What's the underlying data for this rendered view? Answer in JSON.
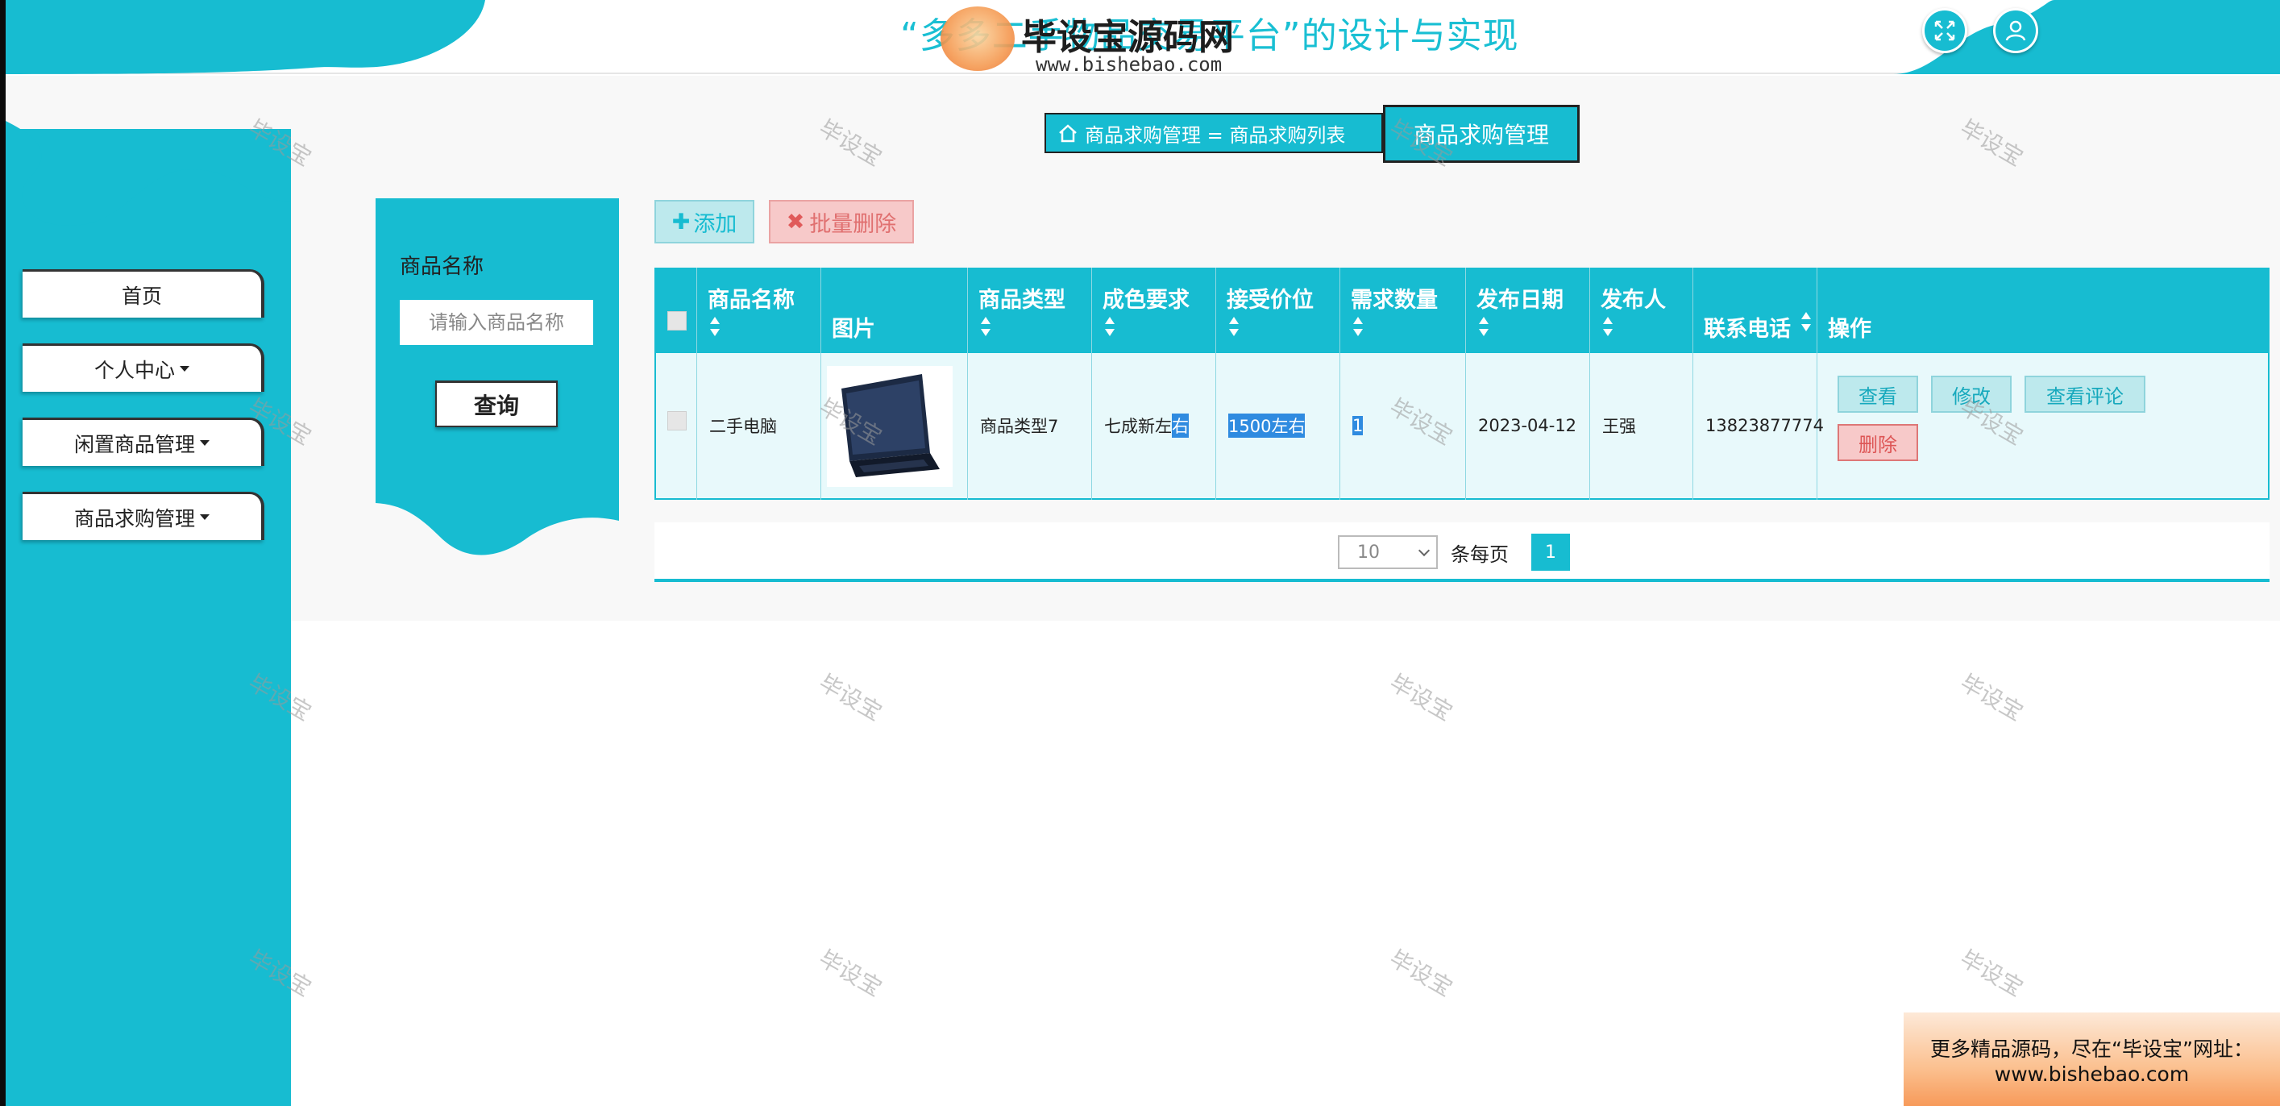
{
  "header": {
    "title": "“多多二手物品交易平台”的设计与实现",
    "watermark_logo_text": "毕设宝源码网",
    "watermark_logo_url": "www.bishebao.com",
    "icons": [
      "fullscreen-icon",
      "user-icon"
    ]
  },
  "breadcrumb": {
    "path": "商品求购管理 = 商品求购列表",
    "current": "商品求购管理"
  },
  "sidebar": {
    "items": [
      {
        "label": "首页",
        "has_caret": false
      },
      {
        "label": "个人中心",
        "has_caret": true
      },
      {
        "label": "闲置商品管理",
        "has_caret": true
      },
      {
        "label": "商品求购管理",
        "has_caret": true
      }
    ]
  },
  "search": {
    "label": "商品名称",
    "placeholder": "请输入商品名称",
    "button": "查询"
  },
  "toolbar": {
    "add_label": "添加",
    "batch_delete_label": "批量删除"
  },
  "table": {
    "columns": [
      "商品名称",
      "图片",
      "商品类型",
      "成色要求",
      "接受价位",
      "需求数量",
      "发布日期",
      "发布人",
      "联系电话",
      "操作"
    ],
    "rows": [
      {
        "name": "二手电脑",
        "image": "laptop-image",
        "type": "商品类型7",
        "condition_a": "七成新左",
        "condition_b": "右",
        "price": "1500左右",
        "quantity": "1",
        "date": "2023-04-12",
        "publisher": "王强",
        "phone": "13823877774",
        "actions": {
          "view": "查看",
          "edit": "修改",
          "comments": "查看评论",
          "delete": "删除"
        }
      }
    ]
  },
  "pagination": {
    "page_size": "10",
    "per_page_label": "条每页",
    "current_page": "1"
  },
  "watermark_text": "毕设宝",
  "promo": {
    "line1": "更多精品源码，尽在“毕设宝”网址：",
    "line2": "www.bishebao.com"
  },
  "colors": {
    "accent": "#17bcd1",
    "add_bg": "#bde9ed",
    "delete_bg": "#f7c9c9"
  }
}
